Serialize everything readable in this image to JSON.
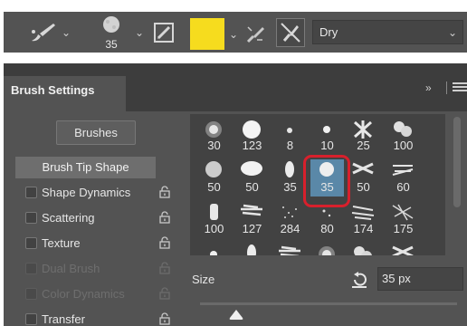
{
  "toolbar": {
    "tool_icon": "brush-tool-icon",
    "brush_preview_size": "35",
    "foreground_color": "#f6dc1e",
    "preset_value": "Dry"
  },
  "panel": {
    "tab_title": "Brush Settings",
    "brushes_button": "Brushes",
    "brush_tip_shape": "Brush Tip Shape",
    "options": [
      {
        "label": "Shape Dynamics",
        "enabled": true
      },
      {
        "label": "Scattering",
        "enabled": true
      },
      {
        "label": "Texture",
        "enabled": true
      },
      {
        "label": "Dual Brush",
        "enabled": false
      },
      {
        "label": "Color Dynamics",
        "enabled": false
      },
      {
        "label": "Transfer",
        "enabled": true
      }
    ],
    "presets": [
      "30",
      "123",
      "8",
      "10",
      "25",
      "100",
      "50",
      "50",
      "35",
      "35",
      "50",
      "60",
      "100",
      "127",
      "284",
      "80",
      "174",
      "175"
    ],
    "selected_preset_index": 9,
    "size_label": "Size",
    "size_value": "35 px",
    "size_slider_fraction": 0.14
  }
}
